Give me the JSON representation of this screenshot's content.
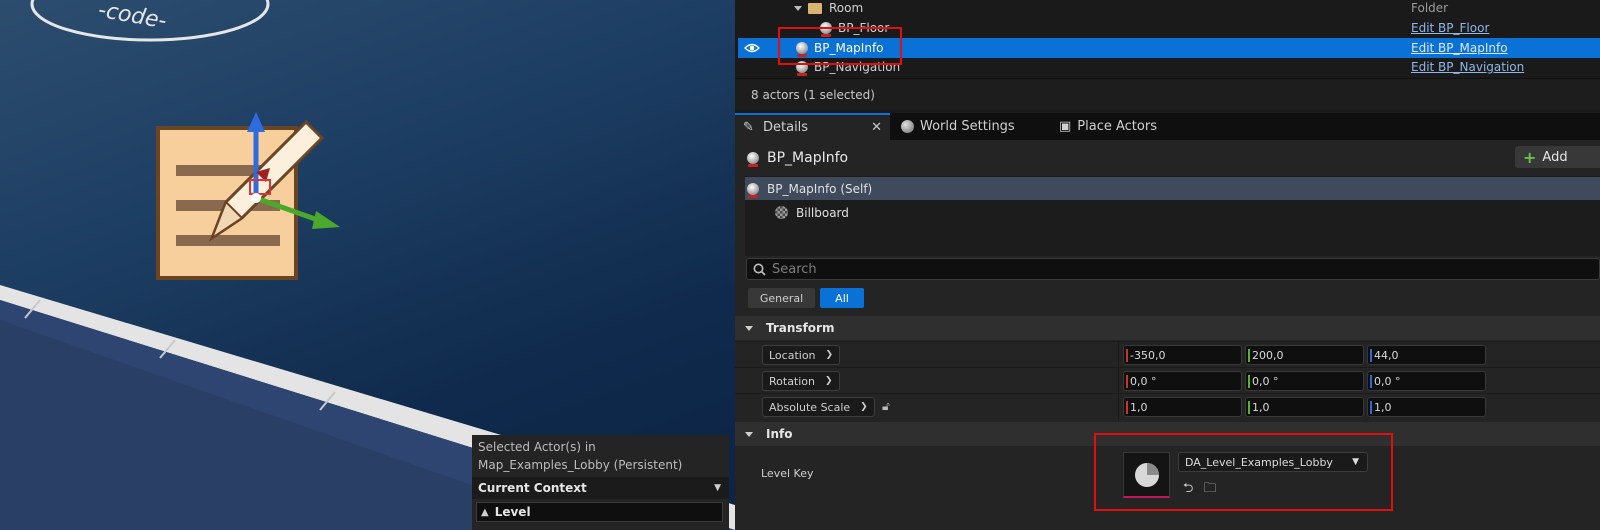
{
  "viewport": {
    "logo_text": "-code- plan",
    "context_panel": {
      "selected_line1": "Selected Actor(s) in",
      "selected_line2": "Map_Examples_Lobby (Persistent)",
      "header": "Current Context",
      "level": "Level"
    }
  },
  "outliner": {
    "rows": [
      {
        "label": "Room",
        "type": "Folder",
        "icon": "folder-icon"
      },
      {
        "label": "BP_Floor",
        "action": "Edit BP_Floor",
        "icon": "actor-icon"
      },
      {
        "label": "BP_MapInfo",
        "action": "Edit BP_MapInfo",
        "icon": "actor-icon",
        "selected": true
      },
      {
        "label": "BP_Navigation",
        "action": "Edit BP_Navigation",
        "icon": "actor-icon"
      }
    ],
    "count": "8 actors (1 selected)"
  },
  "tabs": [
    {
      "label": "Details",
      "active": true,
      "icon": "pencil-icon"
    },
    {
      "label": "World Settings",
      "icon": "globe-icon"
    },
    {
      "label": "Place Actors",
      "icon": "place-actors-icon"
    }
  ],
  "details": {
    "title": "BP_MapInfo",
    "add_label": "Add",
    "components": [
      {
        "label": "BP_MapInfo (Self)",
        "selected": true
      },
      {
        "label": "Billboard"
      }
    ],
    "search_placeholder": "Search",
    "filters": {
      "general": "General",
      "all": "All"
    },
    "transform": {
      "header": "Transform",
      "location": {
        "label": "Location",
        "x": "-350,0",
        "y": "200,0",
        "z": "44,0"
      },
      "rotation": {
        "label": "Rotation",
        "x": "0,0 °",
        "y": "0,0 °",
        "z": "0,0 °"
      },
      "scale": {
        "label": "Absolute Scale",
        "x": "1,0",
        "y": "1,0",
        "z": "1,0"
      }
    },
    "info": {
      "header": "Info",
      "level_key_label": "Level Key",
      "level_key_value": "DA_Level_Examples_Lobby"
    }
  },
  "colors": {
    "accent": "#0a72d6",
    "highlight_box": "#e01010"
  }
}
